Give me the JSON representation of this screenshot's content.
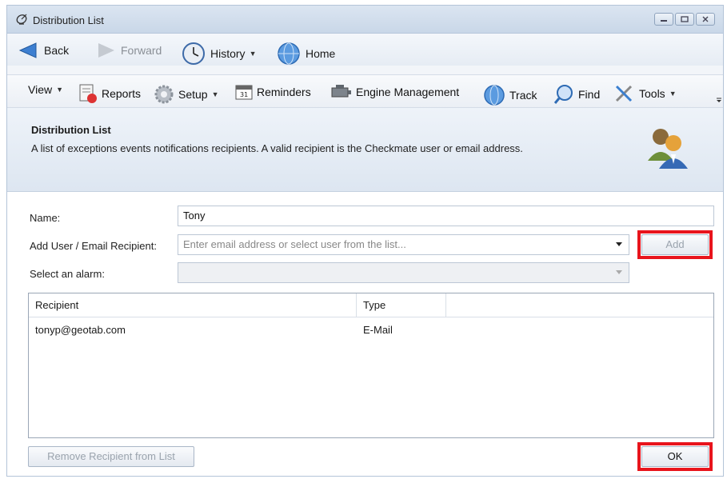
{
  "window": {
    "title": "Distribution List"
  },
  "nav": {
    "back": "Back",
    "forward": "Forward",
    "history": "History",
    "home": "Home"
  },
  "toolbar": {
    "view": "View",
    "reports": "Reports",
    "setup": "Setup",
    "reminders": "Reminders",
    "engine_management": "Engine Management",
    "track": "Track",
    "find": "Find",
    "tools": "Tools"
  },
  "header": {
    "title": "Distribution List",
    "description": "A list of exceptions events notifications recipients. A valid recipient is the Checkmate user or email address."
  },
  "form": {
    "name_label": "Name:",
    "name_value": "Tony",
    "recipient_label": "Add User / Email Recipient:",
    "recipient_placeholder": "Enter email address or select user from the list...",
    "add_button": "Add",
    "alarm_label": "Select an alarm:",
    "alarm_value": ""
  },
  "list": {
    "columns": [
      "Recipient",
      "Type"
    ],
    "rows": [
      {
        "recipient": "tonyp@geotab.com",
        "type": "E-Mail"
      }
    ]
  },
  "footer": {
    "remove_button": "Remove Recipient from List",
    "ok_button": "OK"
  },
  "colors": {
    "highlight": "#e8141c",
    "window_border": "#b4c4d8",
    "header_bg": "#dde6f1"
  }
}
